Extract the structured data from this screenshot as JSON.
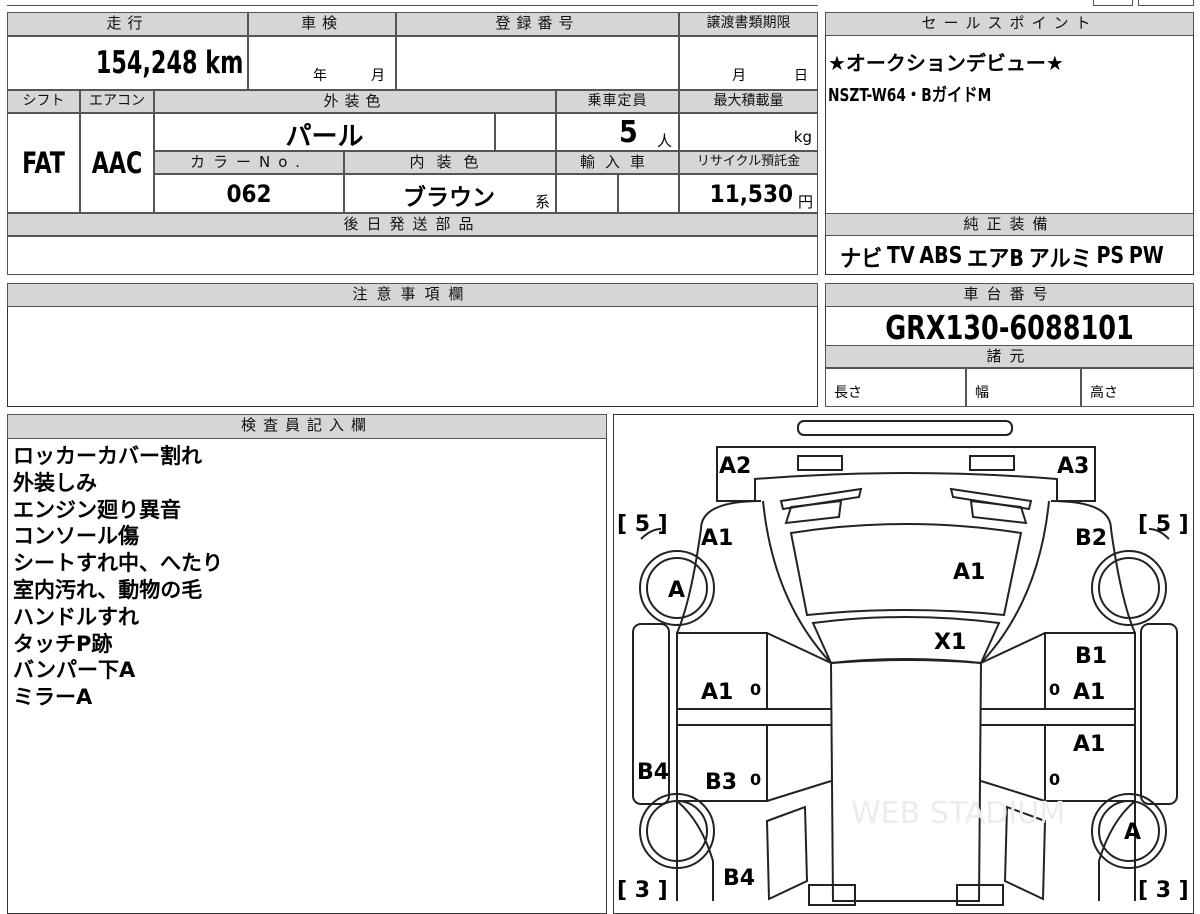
{
  "top_left": {
    "headers": {
      "mileage": "走行",
      "inspection": "車検",
      "registration": "登録番号",
      "transfer_deadline": "譲渡書類期限"
    },
    "mileage": "154,248 km",
    "inspection_year": "年",
    "inspection_month": "月",
    "transfer_month": "月",
    "transfer_day": "日",
    "headers2": {
      "shift": "シフト",
      "aircon": "エアコン",
      "exterior_color": "外装色",
      "capacity": "乗車定員",
      "max_load": "最大積載量"
    },
    "shift": "FAT",
    "aircon": "AAC",
    "exterior_color": "パール",
    "capacity": "5",
    "capacity_unit": "人",
    "max_load_unit": "kg",
    "headers3": {
      "color_no": "カラーNo.",
      "interior_color": "内装色",
      "imported": "輸入車",
      "recycle": "リサイクル預託金"
    },
    "color_no": "062",
    "interior_color": "ブラウン",
    "interior_suffix": "系",
    "recycle_fee": "11,530",
    "recycle_unit": "円",
    "later_parts_header": "後日発送部品",
    "notes_header": "注意事項欄"
  },
  "sales_point": {
    "header": "セールスポイント",
    "lines": [
      "★オークションデビュー★",
      "NSZT-W64・BガイドM"
    ]
  },
  "equipment": {
    "header": "純正装備",
    "items": [
      "ナビ",
      "TV",
      "ABS",
      "エアB",
      "アルミ",
      "PS",
      "PW"
    ]
  },
  "chassis": {
    "header": "車台番号",
    "number": "GRX130-6088101",
    "specs_header": "諸元",
    "length_label": "長さ",
    "width_label": "幅",
    "height_label": "高さ"
  },
  "inspector": {
    "header": "検査員記入欄",
    "notes": [
      "ロッカーカバー割れ",
      "外装しみ",
      "エンジン廻り異音",
      "コンソール傷",
      "シートすれ中、へたり",
      "室内汚れ、動物の毛",
      "ハンドルすれ",
      "タッチP跡",
      "バンパー下A",
      "ミラーA"
    ]
  },
  "diagram": {
    "marks": [
      "A2",
      "A3",
      "A1",
      "B2",
      "A1",
      "A",
      "X1",
      "B1",
      "A1",
      "A1",
      "A1",
      "B4",
      "B3",
      "A",
      "B4",
      "0",
      "0",
      "0",
      "0"
    ],
    "tire_front_left": "[ 5 ]",
    "tire_front_right": "[ 5 ]",
    "tire_rear_left": "[ 3 ]",
    "tire_rear_right": "[ 3 ]",
    "watermark": "WEB STADIUM"
  }
}
